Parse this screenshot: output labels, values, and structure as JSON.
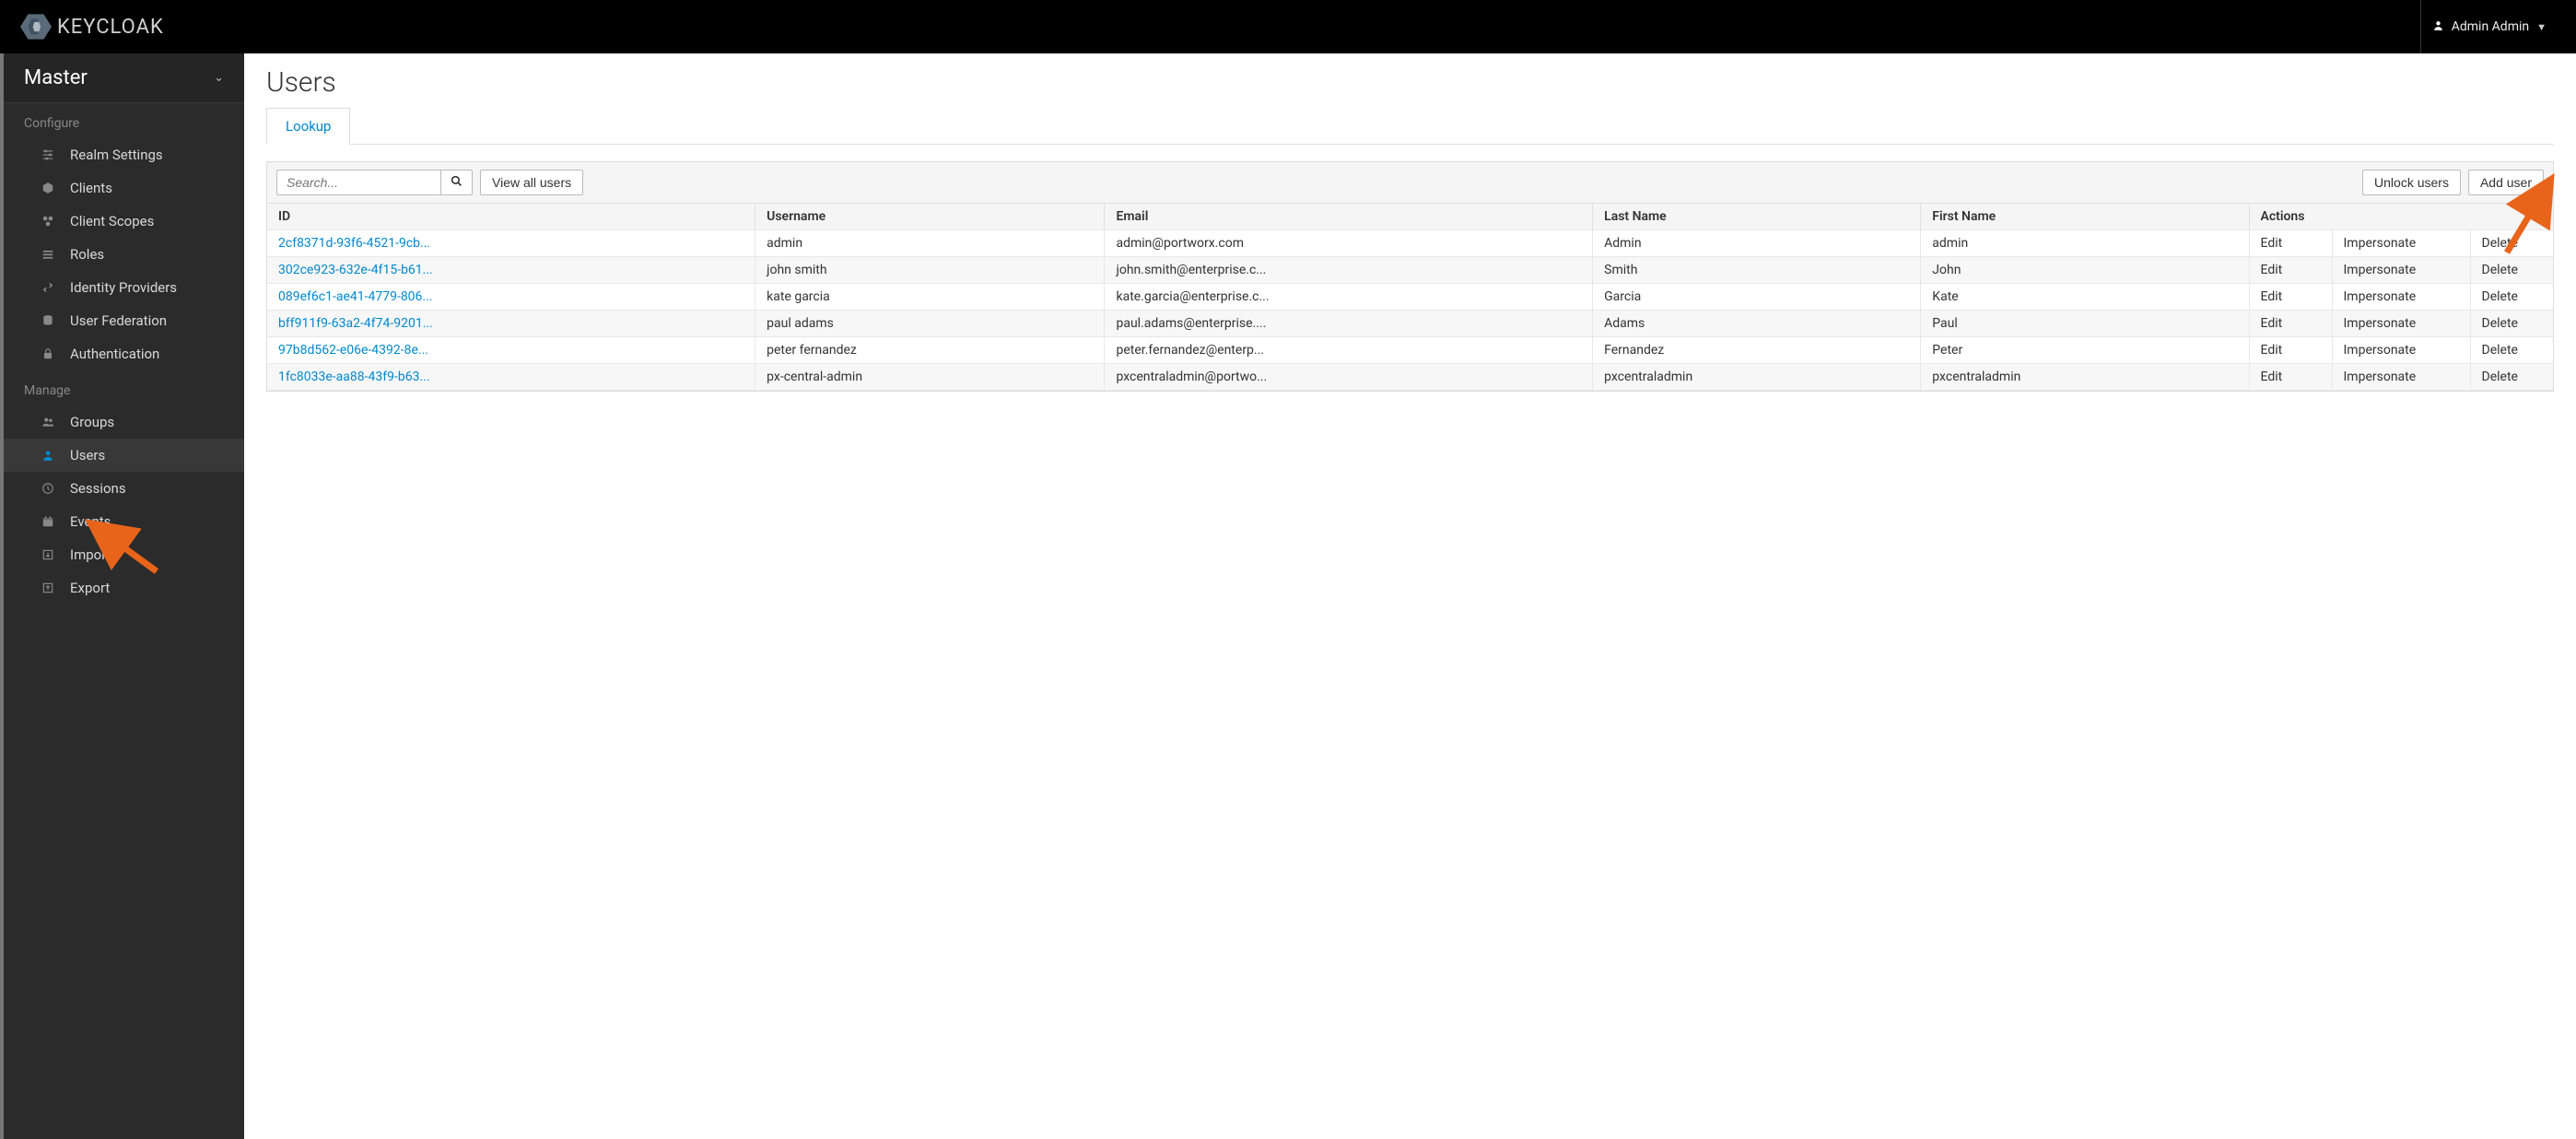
{
  "header": {
    "brand": "KEYCLOAK",
    "user_name": "Admin Admin"
  },
  "sidebar": {
    "realm": "Master",
    "sections": [
      {
        "label": "Configure",
        "items": [
          {
            "label": "Realm Settings",
            "icon": "sliders-icon"
          },
          {
            "label": "Clients",
            "icon": "cube-icon"
          },
          {
            "label": "Client Scopes",
            "icon": "scopes-icon"
          },
          {
            "label": "Roles",
            "icon": "list-icon"
          },
          {
            "label": "Identity Providers",
            "icon": "exchange-icon"
          },
          {
            "label": "User Federation",
            "icon": "database-icon"
          },
          {
            "label": "Authentication",
            "icon": "lock-icon"
          }
        ]
      },
      {
        "label": "Manage",
        "items": [
          {
            "label": "Groups",
            "icon": "group-icon"
          },
          {
            "label": "Users",
            "icon": "user-icon",
            "active": true
          },
          {
            "label": "Sessions",
            "icon": "clock-icon"
          },
          {
            "label": "Events",
            "icon": "calendar-icon"
          },
          {
            "label": "Import",
            "icon": "import-icon"
          },
          {
            "label": "Export",
            "icon": "export-icon"
          }
        ]
      }
    ]
  },
  "main": {
    "title": "Users",
    "tabs": [
      {
        "label": "Lookup",
        "active": true
      }
    ],
    "search_placeholder": "Search...",
    "buttons": {
      "view_all": "View all users",
      "unlock": "Unlock users",
      "add": "Add user"
    },
    "columns": [
      "ID",
      "Username",
      "Email",
      "Last Name",
      "First Name",
      "Actions"
    ],
    "row_actions": [
      "Edit",
      "Impersonate",
      "Delete"
    ],
    "rows": [
      {
        "id": "2cf8371d-93f6-4521-9cb...",
        "username": "admin",
        "email": "admin@portworx.com",
        "last": "Admin",
        "first": "admin"
      },
      {
        "id": "302ce923-632e-4f15-b61...",
        "username": "john smith",
        "email": "john.smith@enterprise.c...",
        "last": "Smith",
        "first": "John"
      },
      {
        "id": "089ef6c1-ae41-4779-806...",
        "username": "kate garcia",
        "email": "kate.garcia@enterprise.c...",
        "last": "Garcia",
        "first": "Kate"
      },
      {
        "id": "bff911f9-63a2-4f74-9201...",
        "username": "paul adams",
        "email": "paul.adams@enterprise....",
        "last": "Adams",
        "first": "Paul"
      },
      {
        "id": "97b8d562-e06e-4392-8e...",
        "username": "peter fernandez",
        "email": "peter.fernandez@enterp...",
        "last": "Fernandez",
        "first": "Peter"
      },
      {
        "id": "1fc8033e-aa88-43f9-b63...",
        "username": "px-central-admin",
        "email": "pxcentraladmin@portwo...",
        "last": "pxcentraladmin",
        "first": "pxcentraladmin"
      }
    ]
  }
}
